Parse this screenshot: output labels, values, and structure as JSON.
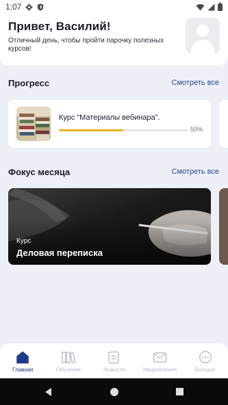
{
  "status_bar": {
    "time": "1:07",
    "icons": [
      "gear-icon",
      "shield-icon",
      "wifi-icon",
      "signal-icon",
      "battery-icon"
    ]
  },
  "header": {
    "title": "Привет, Василий!",
    "subtitle": "Отличный день, чтобы пройти парочку полезных курсов!"
  },
  "progress_section": {
    "title": "Прогресс",
    "see_all": "Смотреть все",
    "card": {
      "course_name": "Курс “Материалы вебинара”.",
      "progress_percent": 50,
      "progress_label": "50%",
      "bar_color": "#e8b41a"
    }
  },
  "focus_section": {
    "title": "Фокус месяца",
    "see_all": "Смотреть все",
    "card": {
      "kind": "Курс",
      "name": "Деловая переписка"
    }
  },
  "bottom_nav": {
    "active_color": "#1f3a8a",
    "inactive_color": "#b9bccb",
    "items": [
      {
        "label": "Главная",
        "icon": "home-icon",
        "active": true
      },
      {
        "label": "Обучение",
        "icon": "books-icon",
        "active": false
      },
      {
        "label": "Новости",
        "icon": "news-icon",
        "active": false
      },
      {
        "label": "Уведомления",
        "icon": "mail-icon",
        "active": false
      },
      {
        "label": "Больше",
        "icon": "more-icon",
        "active": false
      }
    ]
  },
  "system_nav": {
    "icons": [
      "back-icon",
      "home-circle-icon",
      "recents-icon"
    ]
  }
}
